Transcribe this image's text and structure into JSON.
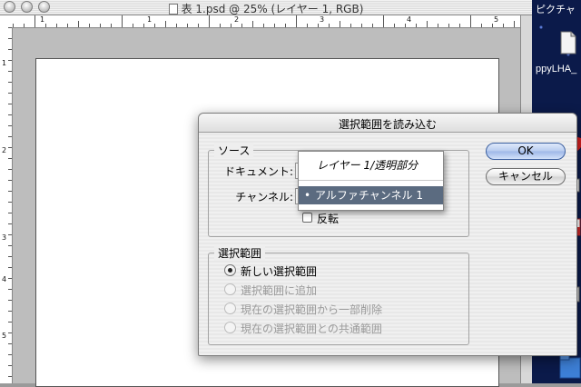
{
  "document_window": {
    "title": "表 1.psd @ 25% (レイヤー 1, RGB)",
    "ruler_h_numbers": [
      "1",
      "1",
      "2",
      "3",
      "4",
      "5"
    ],
    "ruler_v_numbers": [
      "1",
      "2",
      "3",
      "4",
      "5"
    ]
  },
  "desktop": {
    "label_top": "ピクチャ",
    "label_file": "ppyLHA_"
  },
  "dialog": {
    "title": "選択範囲を読み込む",
    "source_group": {
      "legend": "ソース",
      "document_label": "ドキュメント:",
      "channel_label": "チャンネル:",
      "invert_label": "反転",
      "invert_checked": false
    },
    "operation_group": {
      "legend": "選択範囲",
      "options": [
        {
          "label": "新しい選択範囲",
          "checked": true,
          "enabled": true
        },
        {
          "label": "選択範囲に追加",
          "checked": false,
          "enabled": false
        },
        {
          "label": "現在の選択範囲から一部削除",
          "checked": false,
          "enabled": false
        },
        {
          "label": "現在の選択範囲との共通範囲",
          "checked": false,
          "enabled": false
        }
      ]
    },
    "buttons": {
      "ok": "OK",
      "cancel": "キャンセル"
    },
    "popup_menu": {
      "items": [
        {
          "label": "レイヤー 1/透明部分",
          "selected": false
        },
        {
          "label": "アルファチャンネル 1",
          "selected": true,
          "bullet": "•"
        }
      ]
    }
  },
  "colors": {
    "default_button": "#9db7e7",
    "menu_highlight": "#5b6b80",
    "desktop_bg": "#0b1a4a"
  }
}
